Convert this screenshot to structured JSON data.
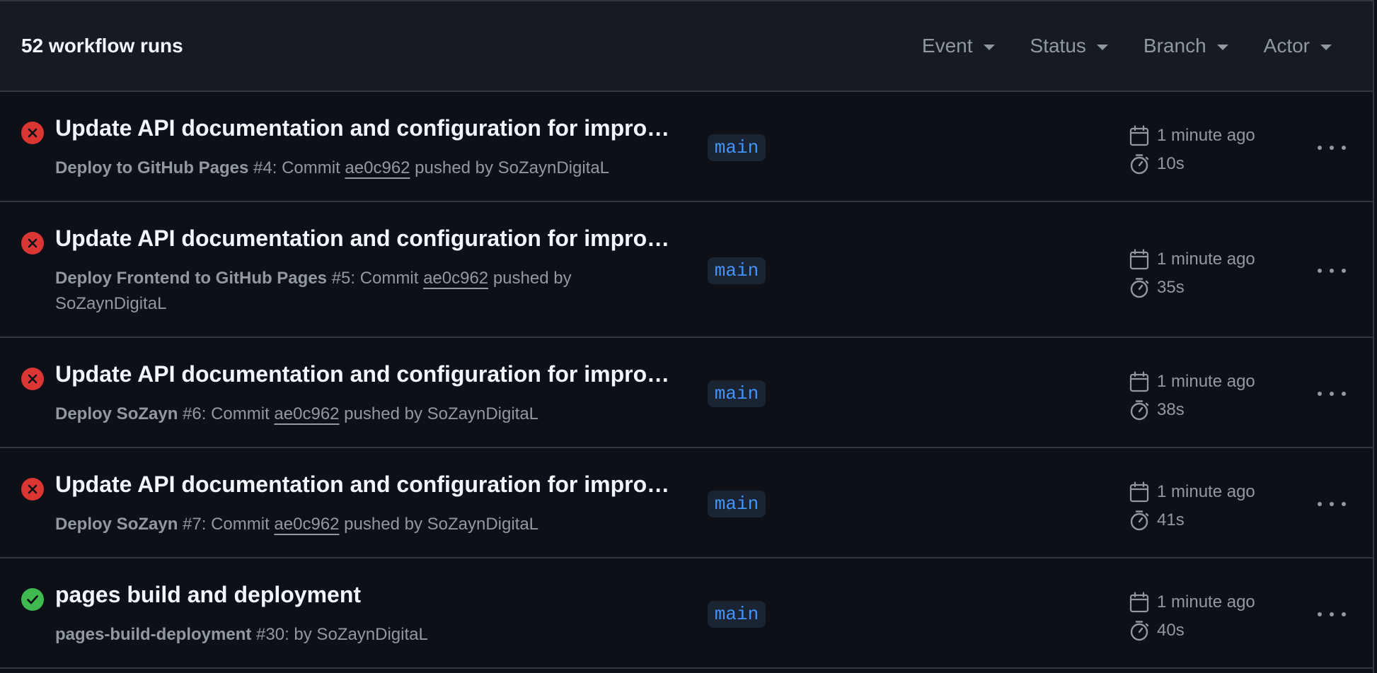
{
  "header": {
    "title": "52 workflow runs",
    "filters": [
      {
        "label": "Event"
      },
      {
        "label": "Status"
      },
      {
        "label": "Branch"
      },
      {
        "label": "Actor"
      }
    ]
  },
  "colors": {
    "failure": "#da3633",
    "success": "#238636",
    "branch_text": "#4493f8",
    "branch_bg": "#1b2433",
    "muted": "#9198a1"
  },
  "runs": [
    {
      "status": "failure",
      "status_icon": "x-circle-icon",
      "title": "Update API documentation and configuration for improv…",
      "workflow": "Deploy to GitHub Pages",
      "run_number": "#4",
      "meta_prefix": ": Commit ",
      "commit": "ae0c962",
      "meta_suffix": " pushed by SoZaynDigitaL",
      "branch": "main",
      "time": "1 minute ago",
      "duration": "10s"
    },
    {
      "status": "failure",
      "status_icon": "x-circle-icon",
      "title": "Update API documentation and configuration for improv…",
      "workflow": "Deploy Frontend to GitHub Pages",
      "run_number": "#5",
      "meta_prefix": ": Commit ",
      "commit": "ae0c962",
      "meta_suffix": " pushed by SoZaynDigitaL",
      "branch": "main",
      "time": "1 minute ago",
      "duration": "35s"
    },
    {
      "status": "failure",
      "status_icon": "x-circle-icon",
      "title": "Update API documentation and configuration for improv…",
      "workflow": "Deploy SoZayn",
      "run_number": "#6",
      "meta_prefix": ": Commit ",
      "commit": "ae0c962",
      "meta_suffix": " pushed by SoZaynDigitaL",
      "branch": "main",
      "time": "1 minute ago",
      "duration": "38s"
    },
    {
      "status": "failure",
      "status_icon": "x-circle-icon",
      "title": "Update API documentation and configuration for improv…",
      "workflow": "Deploy SoZayn",
      "run_number": "#7",
      "meta_prefix": ": Commit ",
      "commit": "ae0c962",
      "meta_suffix": " pushed by SoZaynDigitaL",
      "branch": "main",
      "time": "1 minute ago",
      "duration": "41s"
    },
    {
      "status": "success",
      "status_icon": "check-circle-icon",
      "title": "pages build and deployment",
      "workflow": "pages-build-deployment",
      "run_number": "#30",
      "meta_prefix": ": by SoZaynDigitaL",
      "commit": "",
      "meta_suffix": "",
      "branch": "main",
      "time": "1 minute ago",
      "duration": "40s"
    }
  ]
}
